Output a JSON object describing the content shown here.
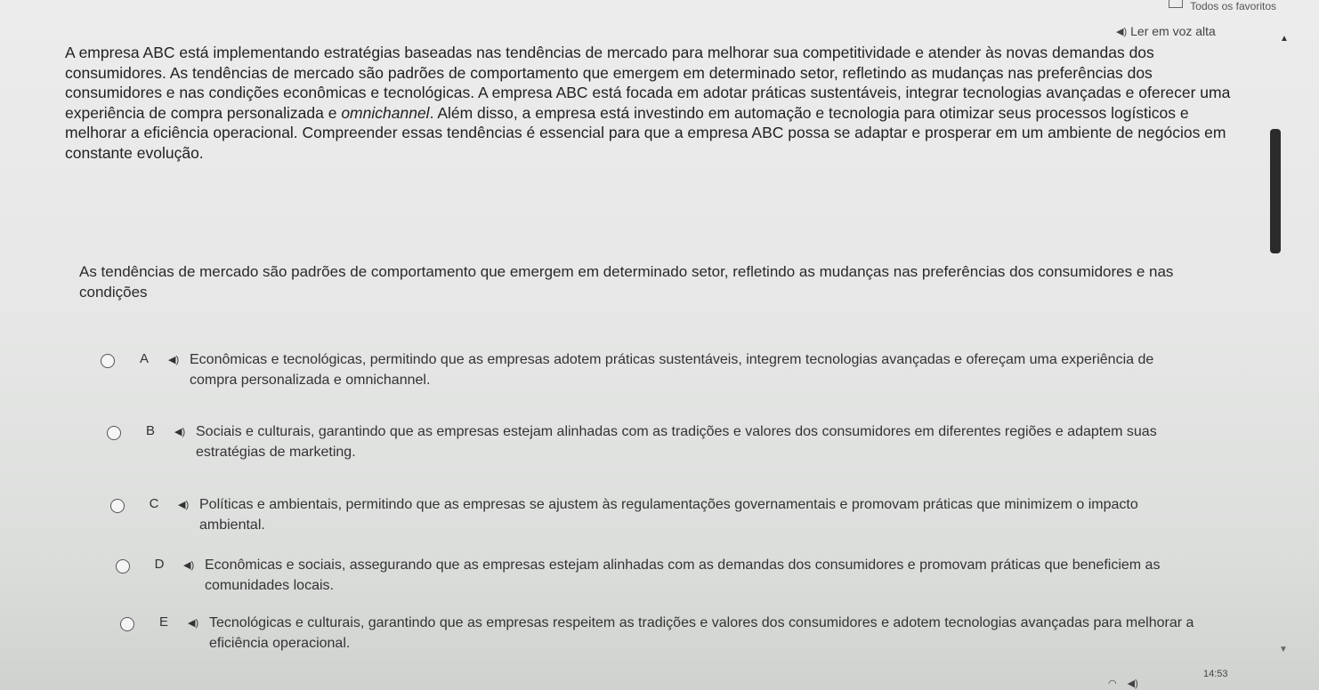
{
  "topbar": {
    "favorites_label": "Todos os favoritos"
  },
  "read_aloud": {
    "label": "Ler em voz alta"
  },
  "passage": {
    "text_before": "A empresa ABC está implementando estratégias baseadas nas tendências de mercado para melhorar sua competitividade e atender às novas demandas dos consumidores. As tendências de mercado são padrões de comportamento que emergem em determinado setor, refletindo as mudanças nas preferências dos consumidores e nas condições econômicas e tecnológicas. A empresa ABC está focada em adotar práticas sustentáveis, integrar tecnologias avançadas e oferecer uma experiência de compra personalizada e ",
    "text_italic": "omnichannel",
    "text_after": ". Além disso, a empresa está investindo em automação e tecnologia para otimizar seus processos logísticos e melhorar a eficiência operacional. Compreender essas tendências é essencial para que a empresa ABC possa se adaptar e prosperar em um ambiente de negócios em constante evolução."
  },
  "question": {
    "text": "As tendências de mercado são padrões de comportamento que emergem em determinado setor, refletindo as mudanças nas preferências dos consumidores e nas condições"
  },
  "options": [
    {
      "letter": "A",
      "text": "Econômicas e tecnológicas, permitindo que as empresas adotem práticas sustentáveis, integrem tecnologias avançadas e ofereçam uma experiência de compra personalizada e omnichannel."
    },
    {
      "letter": "B",
      "text": "Sociais e culturais, garantindo que as empresas estejam alinhadas com as tradições e valores dos consumidores em diferentes regiões e adaptem suas estratégias de marketing."
    },
    {
      "letter": "C",
      "text": "Políticas e ambientais, permitindo que as empresas se ajustem às regulamentações governamentais e promovam práticas que minimizem o impacto ambiental."
    },
    {
      "letter": "D",
      "text": "Econômicas e sociais, assegurando que as empresas estejam alinhadas com as demandas dos consumidores e promovam práticas que beneficiem as comunidades locais."
    },
    {
      "letter": "E",
      "text": "Tecnológicas e culturais, garantindo que as empresas respeitem as tradições e valores dos consumidores e adotem tecnologias avançadas para melhorar a eficiência operacional."
    }
  ],
  "taskbar": {
    "time": "14:53"
  },
  "icons": {
    "speaker": "speaker-icon",
    "favorites": "folder-icon",
    "scroll_up": "chevron-up-icon",
    "scroll_down": "chevron-down-icon"
  }
}
